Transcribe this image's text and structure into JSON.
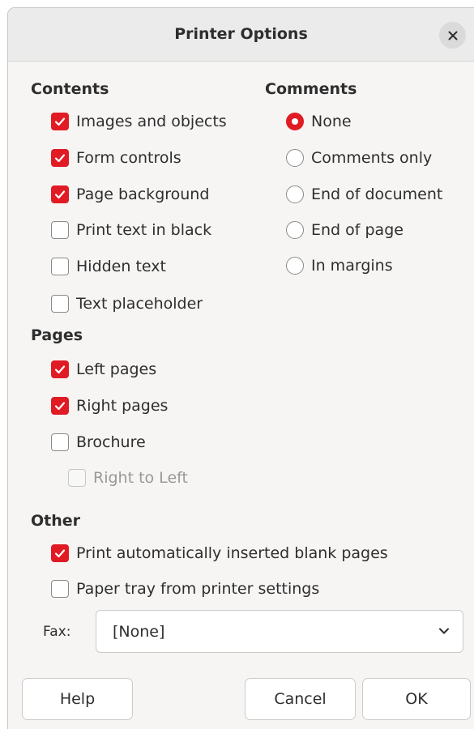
{
  "dialog": {
    "title": "Printer Options"
  },
  "contents": {
    "title": "Contents",
    "items": [
      {
        "label": "Images and objects",
        "checked": true
      },
      {
        "label": "Form controls",
        "checked": true
      },
      {
        "label": "Page background",
        "checked": true
      },
      {
        "label": "Print text in black",
        "checked": false
      },
      {
        "label": "Hidden text",
        "checked": false
      },
      {
        "label": "Text placeholder",
        "checked": false
      }
    ]
  },
  "comments": {
    "title": "Comments",
    "options": [
      {
        "label": "None",
        "selected": true
      },
      {
        "label": "Comments only",
        "selected": false
      },
      {
        "label": "End of document",
        "selected": false
      },
      {
        "label": "End of page",
        "selected": false
      },
      {
        "label": "In margins",
        "selected": false
      }
    ]
  },
  "pages": {
    "title": "Pages",
    "items": [
      {
        "label": "Left pages",
        "checked": true,
        "enabled": true
      },
      {
        "label": "Right pages",
        "checked": true,
        "enabled": true
      },
      {
        "label": "Brochure",
        "checked": false,
        "enabled": true
      },
      {
        "label": "Right to Left",
        "checked": false,
        "enabled": false
      }
    ]
  },
  "other": {
    "title": "Other",
    "items": [
      {
        "label": "Print automatically inserted blank pages",
        "checked": true
      },
      {
        "label": "Paper tray from printer settings",
        "checked": false
      }
    ],
    "fax_label": "Fax:",
    "fax_value": "[None]"
  },
  "buttons": {
    "help": "Help",
    "cancel": "Cancel",
    "ok": "OK"
  },
  "colors": {
    "accent": "#e01b24",
    "titlebar": "#ebebeb",
    "background": "#f6f5f4"
  },
  "icons": {
    "close": "close-icon",
    "check": "check-icon",
    "dropdown": "chevron-down-icon"
  }
}
